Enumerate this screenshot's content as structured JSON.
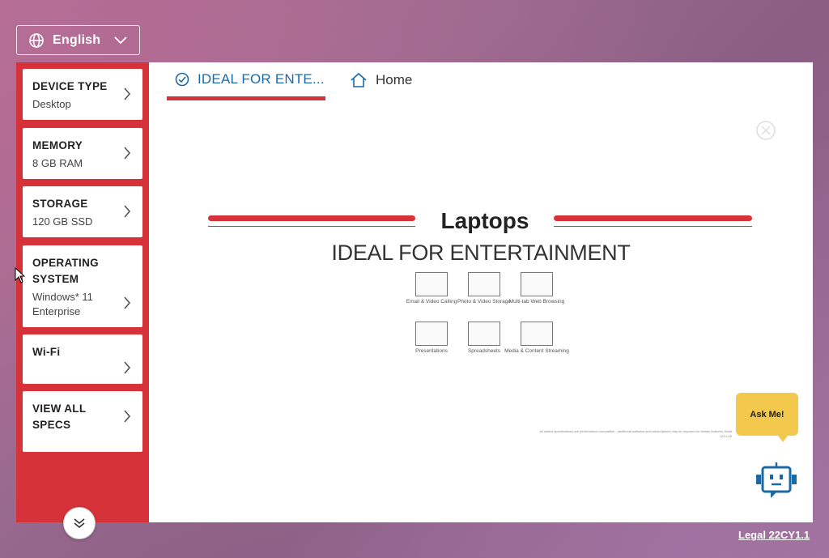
{
  "language": {
    "label": "English",
    "icon": "globe-icon"
  },
  "sidebar": {
    "items": [
      {
        "title": "DEVICE TYPE",
        "value": "Desktop"
      },
      {
        "title": "MEMORY",
        "value": "8 GB RAM"
      },
      {
        "title": "STORAGE",
        "value": "120 GB SSD"
      },
      {
        "title": "OPERATING SYSTEM",
        "value": "Windows* 11 Enterprise"
      },
      {
        "title": "Wi-Fi",
        "value": ""
      },
      {
        "title": "VIEW ALL SPECS",
        "value": ""
      }
    ]
  },
  "tabs": {
    "active": "IDEAL FOR ENTE...",
    "home": "Home"
  },
  "slide": {
    "title": "Laptops",
    "subtitle": "IDEAL FOR ENTERTAINMENT",
    "features": [
      "Email & Video Calling",
      "Photo & Video Storage",
      "Multi-tab Web Browsing",
      "Presentations",
      "Spreadsheets",
      "Media & Content Streaming"
    ],
    "fine_print": "All stated specifications are performance-compatible - additional software and subscriptions may be required for certain features. Build 0221-00"
  },
  "assistant": {
    "prompt": "Ask Me!"
  },
  "footer": {
    "legal": "Legal 22CY1.1"
  },
  "colors": {
    "accent_red": "#d6323a",
    "tab_blue": "#1b6aa8",
    "ask_yellow": "#f2c94c"
  }
}
